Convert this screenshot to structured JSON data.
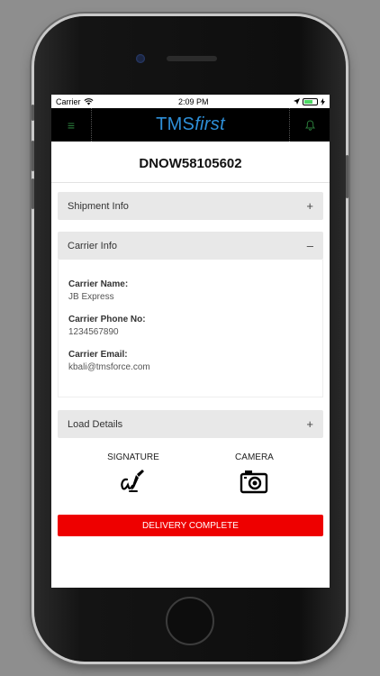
{
  "status": {
    "carrier": "Carrier",
    "time": "2:09 PM",
    "battery_level": 0.7
  },
  "app": {
    "logo_part1": "TMS",
    "logo_part2": "first"
  },
  "order": {
    "id": "DNOW58105602"
  },
  "sections": {
    "shipment": {
      "label": "Shipment Info",
      "toggle": "+"
    },
    "carrier": {
      "label": "Carrier Info",
      "toggle": "–"
    },
    "load": {
      "label": "Load Details",
      "toggle": "+"
    }
  },
  "carrier_info": {
    "name_label": "Carrier Name:",
    "name_value": "JB Express",
    "phone_label": "Carrier Phone No:",
    "phone_value": "1234567890",
    "email_label": "Carrier Email:",
    "email_value": "kbali@tmsforce.com"
  },
  "actions": {
    "signature_label": "SIGNATURE",
    "camera_label": "CAMERA"
  },
  "delivery_button": "DELIVERY COMPLETE",
  "colors": {
    "primary": "#ee0000",
    "logo": "#2e8fd8",
    "nav_icon": "#2a7a3a"
  },
  "icons": [
    "wifi-icon",
    "location-icon",
    "battery-icon",
    "charging-icon",
    "menu-icon",
    "bell-icon",
    "signature-icon",
    "camera-icon"
  ]
}
